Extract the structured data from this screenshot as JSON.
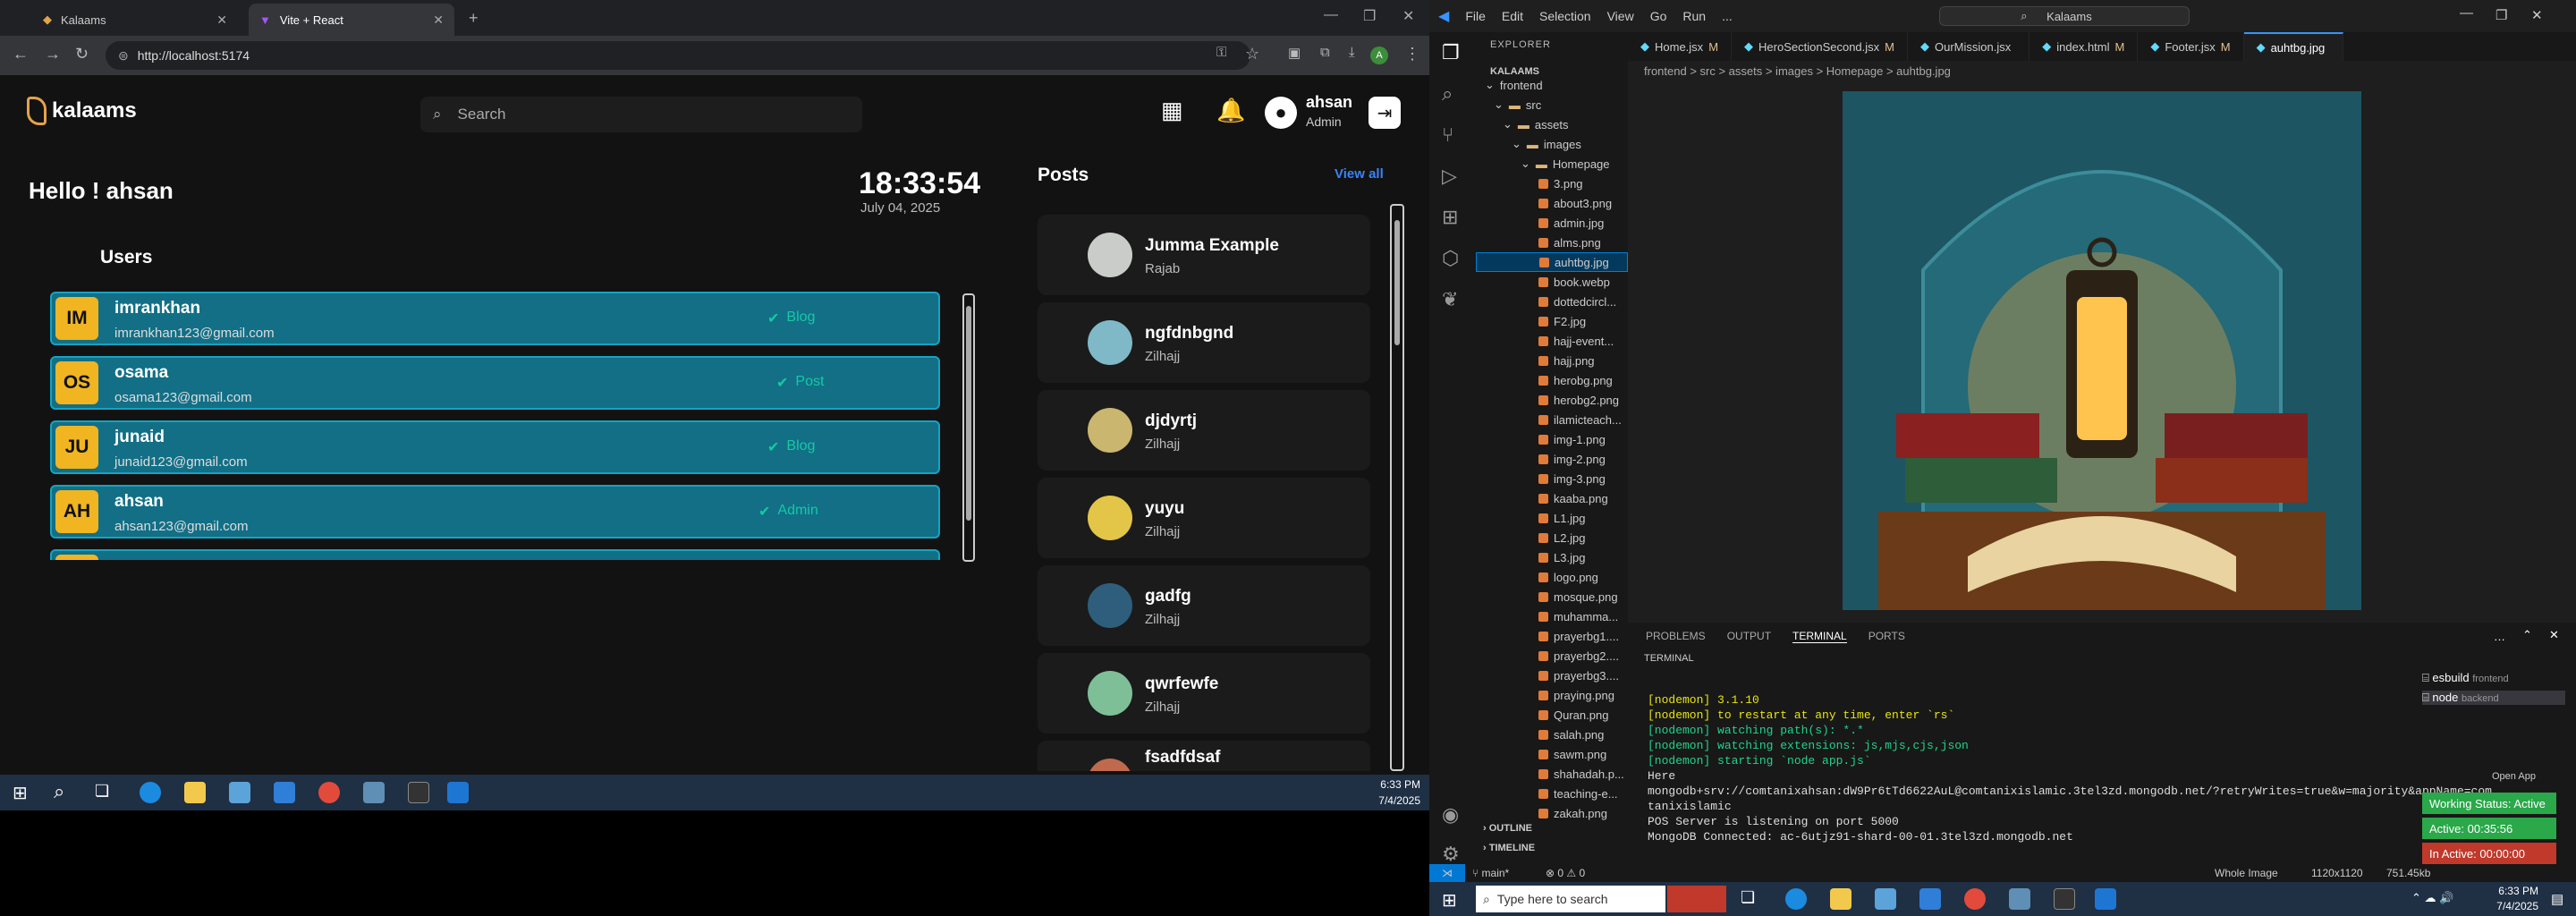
{
  "browser": {
    "tabs": [
      {
        "title": "Kalaams"
      },
      {
        "title": "Vite + React"
      }
    ],
    "url": "http://localhost:5174"
  },
  "app": {
    "logo": "kalaams",
    "search_placeholder": "Search",
    "user": {
      "name": "ahsan",
      "role": "Admin"
    },
    "greeting": "Hello ! ahsan",
    "time": "18:33:54",
    "date": "July 04, 2025",
    "users_heading": "Users",
    "users": [
      {
        "initials": "IM",
        "name": "imrankhan",
        "email": "imrankhan123@gmail.com",
        "role": "Blog"
      },
      {
        "initials": "OS",
        "name": "osama",
        "email": "osama123@gmail.com",
        "role": "Post"
      },
      {
        "initials": "JU",
        "name": "junaid",
        "email": "junaid123@gmail.com",
        "role": "Blog"
      },
      {
        "initials": "AH",
        "name": "ahsan",
        "email": "ahsan123@gmail.com",
        "role": "Admin"
      }
    ],
    "posts_heading": "Posts",
    "view_all": "View all",
    "posts": [
      {
        "title": "Jumma Example",
        "sub": "Rajab",
        "color": "#c9ccc9"
      },
      {
        "title": "ngfdnbgnd",
        "sub": "Zilhajj",
        "color": "#7fb9c7"
      },
      {
        "title": "djdyrtj",
        "sub": "Zilhajj",
        "color": "#cbb670"
      },
      {
        "title": "yuyu",
        "sub": "Zilhajj",
        "color": "#e3c548"
      },
      {
        "title": "gadfg",
        "sub": "Zilhajj",
        "color": "#2e5e7c"
      },
      {
        "title": "qwrfewfe",
        "sub": "Zilhajj",
        "color": "#7fbf98"
      },
      {
        "title": "fsadfdsaf",
        "sub": "",
        "color": "#c06a4d"
      }
    ]
  },
  "taskbar_left": {
    "time": "6:33 PM",
    "date": "7/4/2025"
  },
  "vscode": {
    "menu": [
      "File",
      "Edit",
      "Selection",
      "View",
      "Go",
      "Run",
      "..."
    ],
    "command_center": "Kalaams",
    "explorer_title": "EXPLORER",
    "workspace": "KALAAMS",
    "folders": [
      "frontend",
      "src",
      "assets",
      "images",
      "Homepage"
    ],
    "files": [
      "3.png",
      "about3.png",
      "admin.jpg",
      "alms.png",
      "auhtbg.jpg",
      "book.webp",
      "dottedcircl...",
      "F2.jpg",
      "hajj-event...",
      "hajj.png",
      "herobg.png",
      "herobg2.png",
      "ilamicteach...",
      "img-1.png",
      "img-2.png",
      "img-3.png",
      "kaaba.png",
      "L1.jpg",
      "L2.jpg",
      "L3.jpg",
      "logo.png",
      "mosque.png",
      "muhamma...",
      "prayerbg1....",
      "prayerbg2....",
      "prayerbg3....",
      "praying.png",
      "Quran.png",
      "salah.png",
      "sawm.png",
      "shahadah.p...",
      "teaching-e...",
      "zakah.png"
    ],
    "selected_file": "auhtbg.jpg",
    "outline": "OUTLINE",
    "timeline": "TIMELINE",
    "editor_tabs": [
      {
        "name": "Home.jsx",
        "mod": "M"
      },
      {
        "name": "HeroSectionSecond.jsx",
        "mod": "M"
      },
      {
        "name": "OurMission.jsx",
        "mod": ""
      },
      {
        "name": "index.html",
        "mod": "M"
      },
      {
        "name": "Footer.jsx",
        "mod": "M"
      },
      {
        "name": "auhtbg.jpg",
        "mod": ""
      }
    ],
    "breadcrumb": "frontend > src > assets > images > Homepage > auhtbg.jpg",
    "panel_tabs": [
      "PROBLEMS",
      "OUTPUT",
      "TERMINAL",
      "PORTS"
    ],
    "terminal_label": "TERMINAL",
    "terminal_lines": [
      "[nodemon] 3.1.10",
      "[nodemon] to restart at any time, enter `rs`",
      "[nodemon] watching path(s): *.*",
      "[nodemon] watching extensions: js,mjs,cjs,json",
      "[nodemon] starting `node app.js`",
      "Here",
      "mongodb+srv://comtanixahsan:dW9Pr6tTd6622AuL@comtanixislamic.3tel3zd.mongodb.net/?retryWrites=true&w=majority&appName=com",
      "tanixislamic",
      "POS Server is listening on port 5000",
      "MongoDB Connected: ac-6utjz91-shard-00-01.3tel3zd.mongodb.net"
    ],
    "terminals": [
      {
        "name": "esbuild",
        "folder": "frontend"
      },
      {
        "name": "node",
        "folder": "backend"
      }
    ],
    "open_app": "Open App",
    "work_status": "Working Status: Active",
    "active": "Active: 00:35:56",
    "inactive": "In Active: 00:00:00",
    "status_branch": "main*",
    "status_errors": "0 ⚠ 0",
    "status_whole": "Whole Image",
    "status_size": "1120x1120",
    "status_kb": "751.45kb"
  },
  "taskbar_right": {
    "search": "Type here to search",
    "time": "6:33 PM",
    "date": "7/4/2025"
  }
}
